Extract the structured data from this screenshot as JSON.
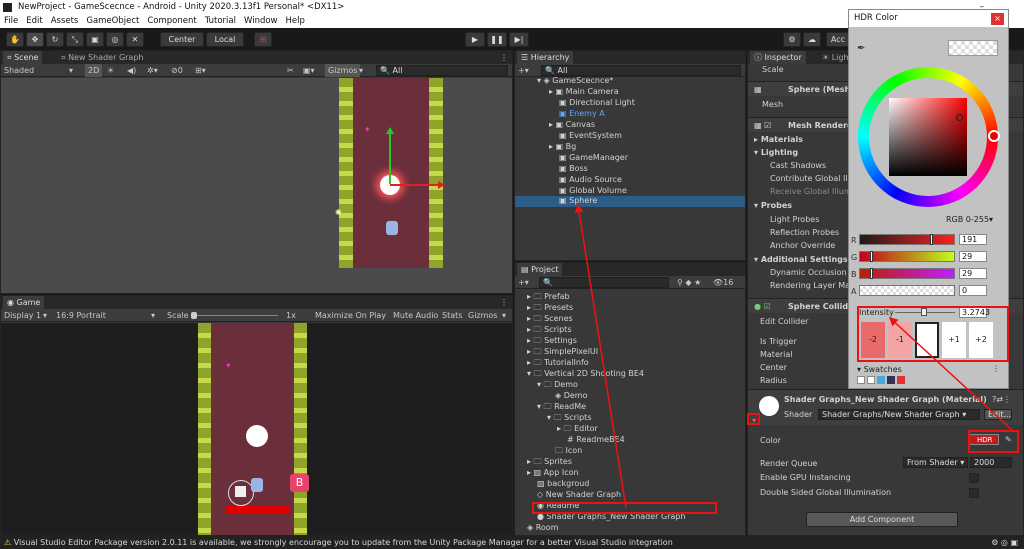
{
  "window": {
    "title": "NewProject - GameScecnce - Android - Unity 2020.3.13f1 Personal* <DX11>"
  },
  "menu": [
    "File",
    "Edit",
    "Assets",
    "GameObject",
    "Component",
    "Tutorial",
    "Window",
    "Help"
  ],
  "toolbar": {
    "center": "Center",
    "local": "Local",
    "account": "Acc"
  },
  "scene": {
    "tab": "Scene",
    "tab2": "New Shader Graph",
    "shading": "Shaded",
    "mode2d": "2D",
    "gizmos": "Gizmos",
    "search": "All",
    "hidden_count": "0"
  },
  "game": {
    "tab": "Game",
    "display": "Display 1",
    "aspect": "16:9 Portrait",
    "scale_label": "Scale",
    "scale_val": "1x",
    "maximize": "Maximize On Play",
    "mute": "Mute Audio",
    "stats": "Stats",
    "gizmos": "Gizmos"
  },
  "hierarchy": {
    "tab": "Hierarchy",
    "search": "All",
    "scene_name": "GameScecnce*",
    "items": [
      "Main Camera",
      "Directional Light",
      "Enemy A",
      "Canvas",
      "EventSystem",
      "Bg",
      "GameManager",
      "Boss",
      "Audio Source",
      "Global Volume",
      "Sphere"
    ]
  },
  "project": {
    "tab": "Project",
    "count": "16",
    "items": [
      "Prefab",
      "Presets",
      "Scenes",
      "Scripts",
      "Settings",
      "SimplePixelUI",
      "TutorialInfo",
      "Vertical 2D Shooting BE4",
      "Demo",
      "Demo",
      "ReadMe",
      "Scripts",
      "Editor",
      "ReadmeBE4",
      "Icon",
      "Sprites",
      "App Icon",
      "backgroud",
      "New Shader Graph",
      "Readme",
      "Shader Graphs_New Shader Graph",
      "Room"
    ]
  },
  "inspector": {
    "tab": "Inspector",
    "tab2": "Light",
    "scale": "Scale",
    "sphere_mesh": "Sphere (Mesh",
    "mesh": "Mesh",
    "mesh_renderer": "Mesh Rendere",
    "materials": "Materials",
    "lighting": "Lighting",
    "cast_shadows": "Cast Shadows",
    "contribute": "Contribute Global Ill",
    "receive": "Receive Global Illum",
    "probes": "Probes",
    "light_probes": "Light Probes",
    "refl_probes": "Reflection Probes",
    "anchor": "Anchor Override",
    "additional": "Additional Settings",
    "dyn_occ": "Dynamic Occlusion",
    "render_layer": "Rendering Layer Ma",
    "sphere_collider": "Sphere Collide",
    "edit_collider": "Edit Collider",
    "is_trigger": "Is Trigger",
    "material": "Material",
    "center": "Center",
    "radius": "Radius",
    "mat_name": "Shader Graphs_New Shader Graph (Material)",
    "shader_label": "Shader",
    "shader_val": "Shader Graphs/New Shader Graph",
    "edit": "Edit...",
    "color_label": "Color",
    "hdr": "HDR",
    "render_queue": "Render Queue",
    "from_shader": "From Shader",
    "queue_val": "2000",
    "gpu": "Enable GPU Instancing",
    "dsgi": "Double Sided Global Illumination",
    "add_component": "Add Component"
  },
  "hdr_picker": {
    "title": "HDR Color",
    "mode": "RGB 0-255",
    "r": "191",
    "g": "29",
    "b": "29",
    "a": "0",
    "intensity_label": "Intensity",
    "intensity": "3.2743",
    "stops": [
      "-2",
      "-1",
      "",
      "+1",
      "+2"
    ],
    "swatches": "Swatches",
    "channels": [
      "R",
      "G",
      "B",
      "A"
    ]
  },
  "status": {
    "text": "Visual Studio Editor Package version 2.0.11 is available, we strongly encourage you to update from the Unity Package Manager for a better Visual Studio integration"
  },
  "colors": {
    "accent": "#2c5d87",
    "red": "#e11",
    "hdr_color": "#bf1d1d"
  }
}
